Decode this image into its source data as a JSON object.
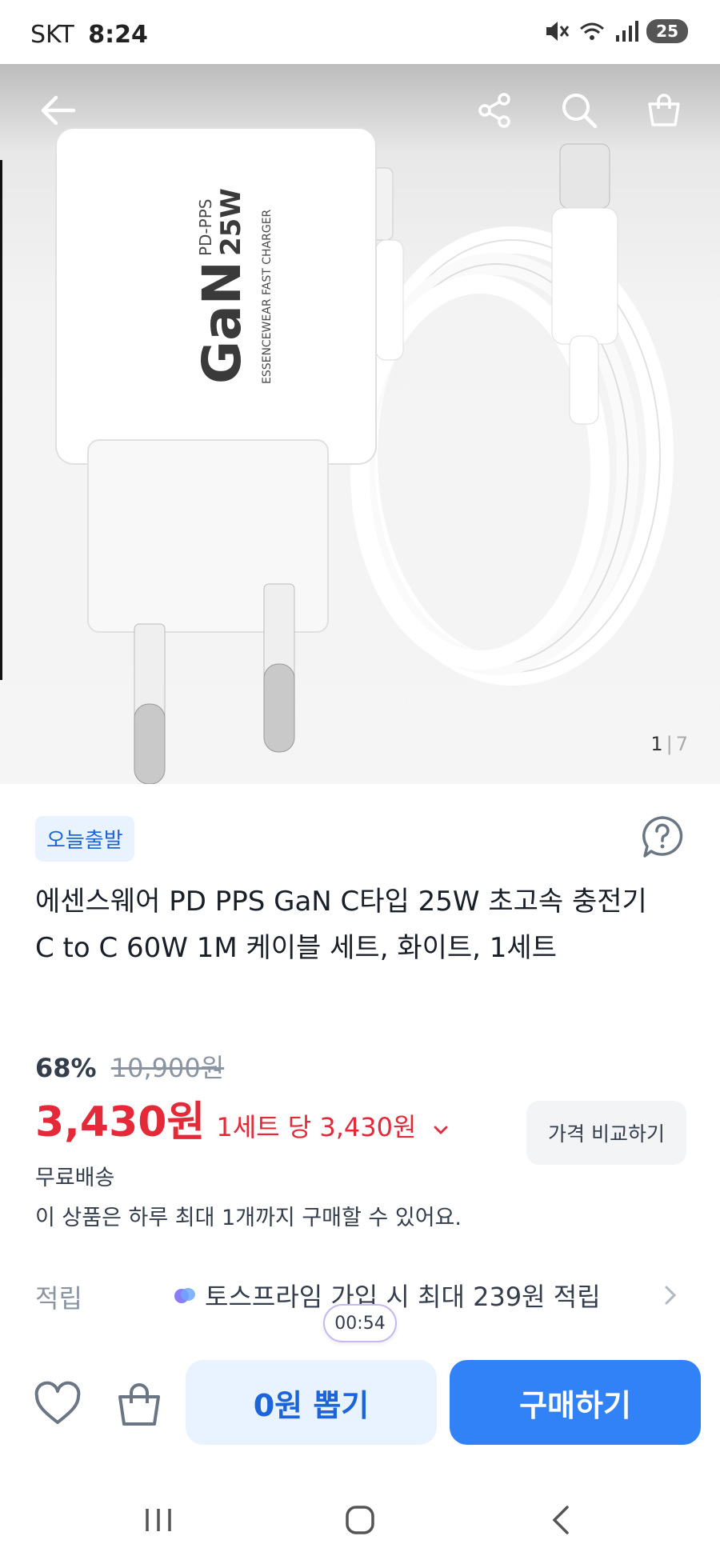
{
  "status_bar": {
    "carrier": "SKT",
    "time": "8:24",
    "battery": "25",
    "icons": [
      "mute-icon",
      "wifi-icon",
      "signal-icon",
      "battery-icon"
    ]
  },
  "hero": {
    "icons": [
      "back-arrow-icon",
      "share-icon",
      "search-icon",
      "cart-icon"
    ],
    "page_current": "1",
    "page_total": "7"
  },
  "product": {
    "badge": "오늘출발",
    "title": "에센스웨어 PD PPS GaN C타입 25W 초고속 충전기 C to C 60W 1M 케이블 세트, 화이트, 1세트",
    "discount_rate": "68%",
    "original_price": "10,900원",
    "price": "3,430원",
    "unit_price": "1세트 당 3,430원",
    "compare_label": "가격 비교하기",
    "shipping": "무료배송",
    "purchase_limit": "이 상품은 하루 최대 1개까지 구매할 수 있어요."
  },
  "reward": {
    "label": "적립",
    "text": "토스프라임 가입 시 최대 239원 적립",
    "timer": "00:54"
  },
  "actions": {
    "draw_label": "0원 뽑기",
    "buy_label": "구매하기"
  },
  "colors": {
    "accent": "#3182f6",
    "price_red": "#e42939",
    "badge_bg": "#e8f3ff",
    "badge_text": "#1b64da"
  }
}
